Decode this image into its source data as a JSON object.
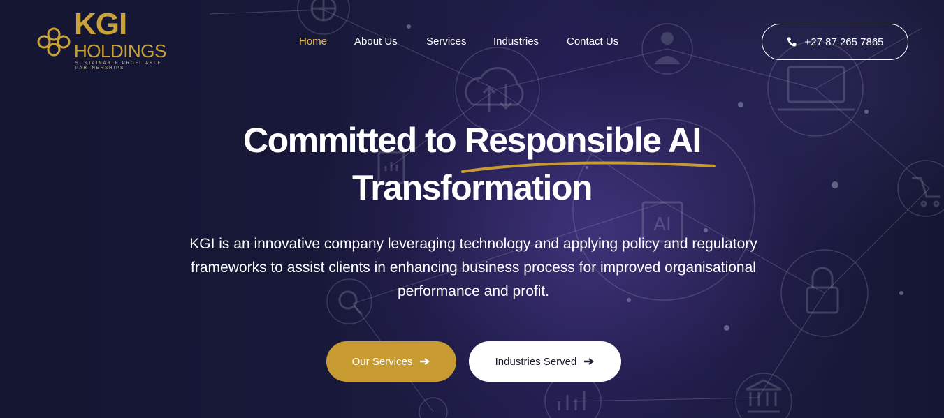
{
  "logo": {
    "name_line1": "KGI",
    "name_line2": "HOLDINGS",
    "tagline": "SUSTAINABLE PROFITABLE PARTNERSHIPS",
    "brand_color": "#c9a23a"
  },
  "nav": {
    "items": [
      {
        "label": "Home",
        "active": true
      },
      {
        "label": "About Us",
        "active": false
      },
      {
        "label": "Services",
        "active": false
      },
      {
        "label": "Industries",
        "active": false
      },
      {
        "label": "Contact Us",
        "active": false
      }
    ],
    "active_color": "#e2b94f"
  },
  "header": {
    "phone": "+27 87 265 7865",
    "phone_icon": "phone-icon"
  },
  "hero": {
    "title_line1": "Committed to Responsible AI",
    "title_line2": "Transformation",
    "description": "KGI is an innovative company leveraging technology and applying policy and regulatory frameworks to assist clients in enhancing business process for improved organisational performance and profit."
  },
  "buttons": {
    "primary_label": "Our Services",
    "secondary_label": "Industries Served",
    "arrow_icon": "arrow-right-icon",
    "primary_color": "#c79a32"
  },
  "background_icons": [
    "globe-icon",
    "businessman-icon",
    "cloud-sync-icon",
    "laptop-icon",
    "document-chart-icon",
    "shopping-cart-icon",
    "ai-chip-icon",
    "magnifier-icon",
    "padlock-icon",
    "bar-chart-icon",
    "bank-icon",
    "pie-chart-icon"
  ]
}
